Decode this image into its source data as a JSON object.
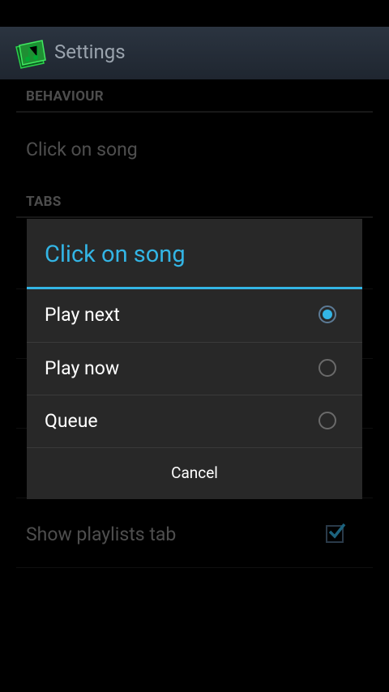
{
  "actionbar": {
    "title": "Settings"
  },
  "sections": {
    "behaviour": "BEHAVIOUR",
    "tabs": "TABS"
  },
  "prefs": {
    "click_on_song": "Click on song",
    "show_playlists_tab": "Show playlists tab",
    "show_playlists_checked": true
  },
  "dialog": {
    "title": "Click on song",
    "options": [
      {
        "label": "Play next",
        "selected": true
      },
      {
        "label": "Play now",
        "selected": false
      },
      {
        "label": "Queue",
        "selected": false
      }
    ],
    "cancel": "Cancel"
  },
  "colors": {
    "accent": "#33b5e5",
    "background": "#000000",
    "dialog": "#282828"
  },
  "icons": {
    "app": "music-note-icon",
    "check": "checkmark-icon"
  }
}
